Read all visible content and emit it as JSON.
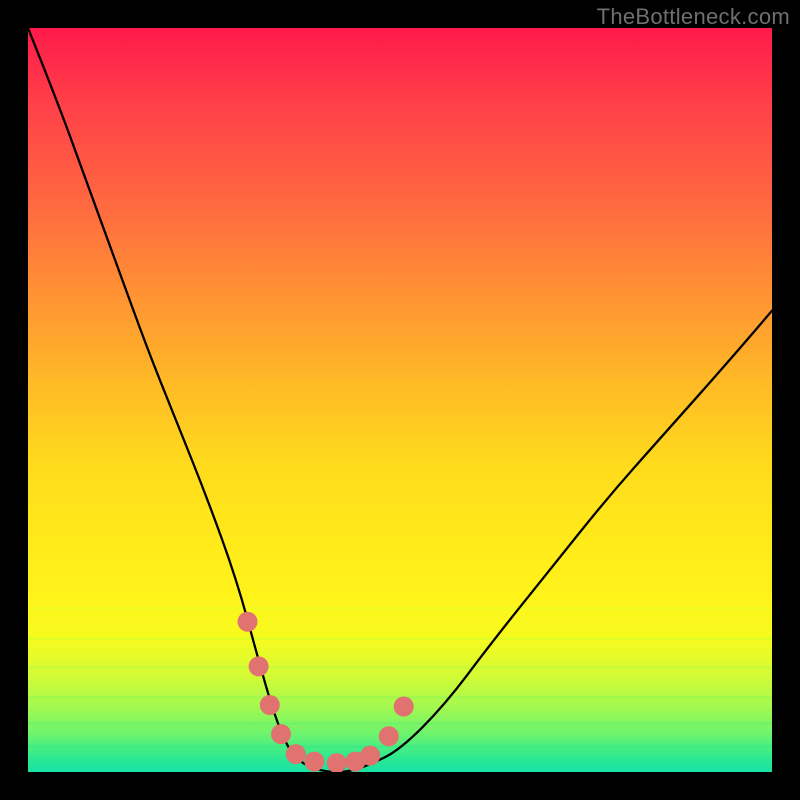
{
  "watermark": {
    "text": "TheBottleneck.com"
  },
  "colors": {
    "frame": "#000000",
    "curve_stroke": "#000000",
    "marker_fill": "#e0736f",
    "tick_colors": [
      "#e9ff26",
      "#d4ff2c",
      "#bbfb3c",
      "#95f851",
      "#66f16d",
      "#39ea88",
      "#1fe59d"
    ]
  },
  "chart_data": {
    "type": "line",
    "title": "",
    "xlabel": "",
    "ylabel": "",
    "xlim": [
      0,
      100
    ],
    "ylim": [
      0,
      100
    ],
    "series": [
      {
        "name": "curve",
        "x": [
          0,
          4,
          8,
          12,
          16,
          20,
          24,
          28,
          31,
          33,
          35,
          37,
          40,
          43,
          46,
          50,
          56,
          62,
          70,
          78,
          86,
          94,
          100
        ],
        "values": [
          100,
          90,
          79,
          68,
          57,
          47,
          37,
          26,
          15,
          8,
          3,
          1,
          0,
          0,
          1,
          3,
          9,
          17,
          27,
          37,
          46,
          55,
          62
        ]
      }
    ],
    "markers": {
      "name": "points",
      "x": [
        29.5,
        31.0,
        32.5,
        34.0,
        36.0,
        38.5,
        41.5,
        44.0,
        46.0,
        48.5,
        50.5
      ],
      "values": [
        20.2,
        14.2,
        9.0,
        5.1,
        2.4,
        1.4,
        1.2,
        1.4,
        2.2,
        4.8,
        8.8
      ]
    },
    "ticks_y": [
      78,
      82,
      86,
      90,
      93.5,
      96.5,
      99
    ]
  }
}
